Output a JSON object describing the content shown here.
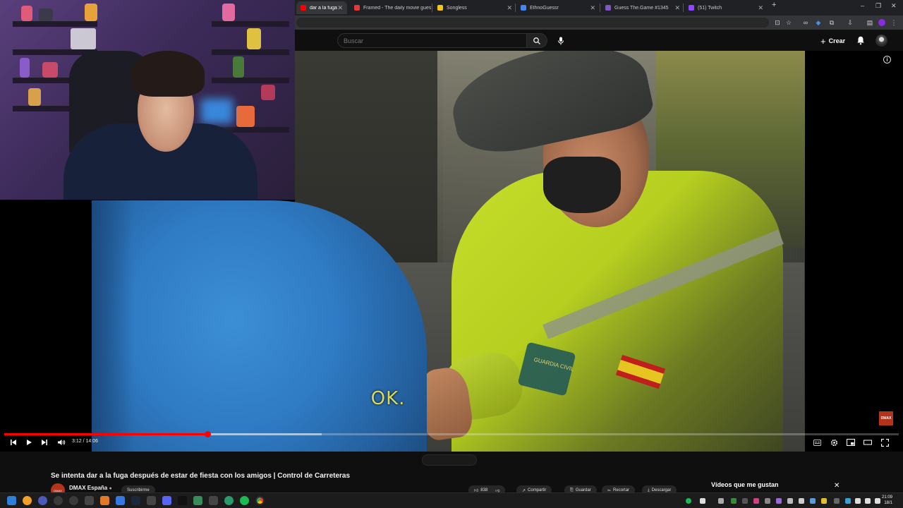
{
  "browser": {
    "tabs": [
      {
        "title": "dar a la fuga después",
        "active": true,
        "favicon_color": "#ff0000"
      },
      {
        "title": "Framed - The daily movie gues",
        "active": false,
        "favicon_color": "#e53935"
      },
      {
        "title": "Songless",
        "active": false,
        "favicon_color": "#f5c518"
      },
      {
        "title": "EthnoGuessr",
        "active": false,
        "favicon_color": "#4285f4"
      },
      {
        "title": "Guess The.Game #1345",
        "active": false,
        "favicon_color": "#7e57c2"
      },
      {
        "title": "(51) Twitch",
        "active": false,
        "favicon_color": "#9146ff"
      }
    ],
    "new_tab_symbol": "+",
    "window_controls": {
      "minimize": "–",
      "maximize": "❐",
      "close": "✕"
    }
  },
  "youtube": {
    "search_placeholder": "Buscar",
    "create_label": "Crear",
    "icons": [
      "search-icon",
      "mic-icon",
      "bell-icon",
      "info-icon"
    ]
  },
  "video": {
    "subtitle": "OK.",
    "watermark": "DMAX",
    "badge_text": "GUARDIA CIVIL",
    "current_time": "3:12",
    "duration": "14:06",
    "time_display": "3:12 / 14:06",
    "progress_fraction": 0.227,
    "buffer_fraction": 0.355
  },
  "meta": {
    "title": "Se intenta dar a la fuga después de estar de fiesta con los amigos | Control de Carreteras",
    "channel": "DMAX España",
    "channel_avatar_text": "DMAX",
    "subscribe_label": "Suscribirme",
    "like_count": "838",
    "actions": [
      "Compartir",
      "Guardar",
      "Recortar",
      "Descargar"
    ],
    "side_panel_title": "Vídeos que me gustan"
  },
  "taskbar": {
    "clock_time": "21:09",
    "clock_date": "18/1"
  },
  "colors": {
    "youtube_red": "#ff0000",
    "background": "#0f0f0f",
    "subtitle": "#d9d95a",
    "dmax": "#b4331b"
  }
}
